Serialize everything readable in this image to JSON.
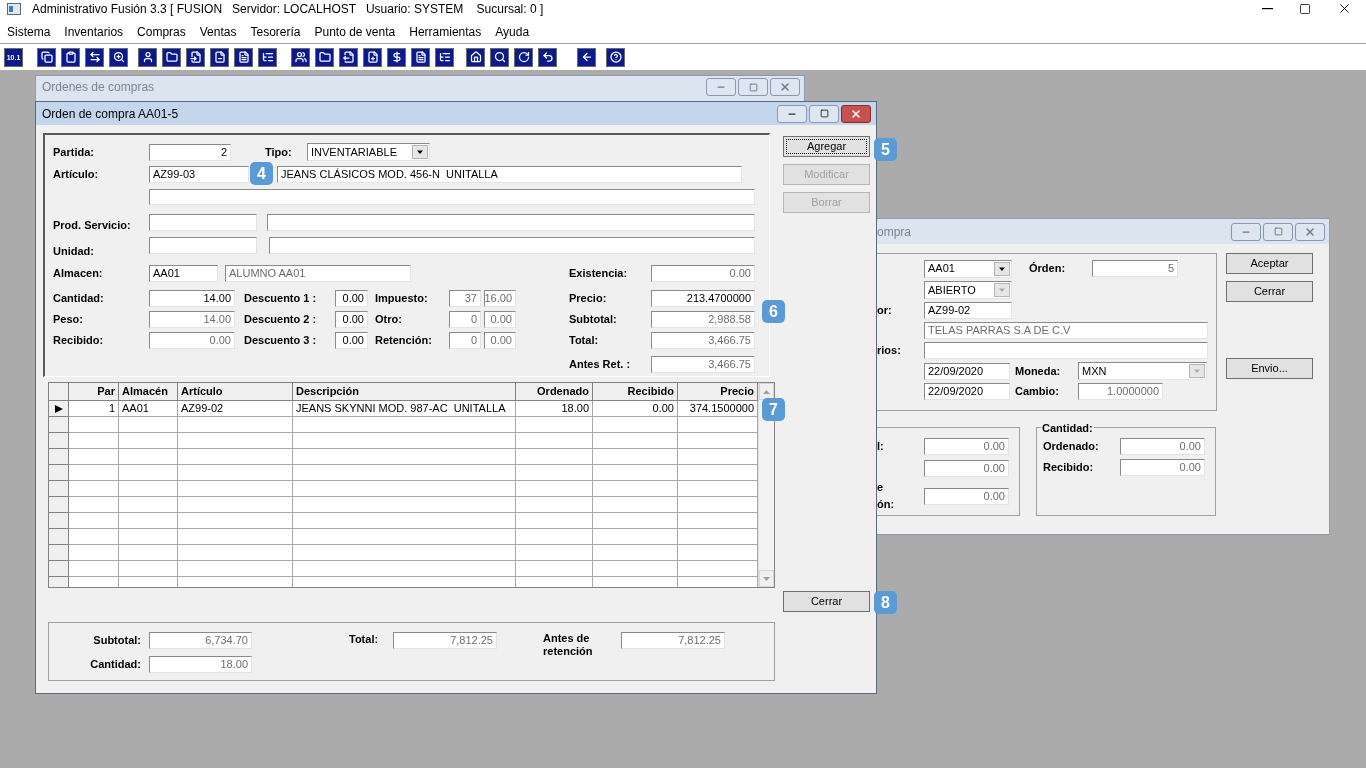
{
  "app": {
    "title": "Administrativo Fusión 3.3 [ FUSION   Servidor: LOCALHOST   Usuario: SYSTEM    Sucursal: 0 ]"
  },
  "menu": [
    "Sistema",
    "Inventarios",
    "Compras",
    "Ventas",
    "Tesorería",
    "Punto de venta",
    "Herramientas",
    "Ayuda"
  ],
  "toolbar": {
    "first_label": "10.1"
  },
  "orders_window": {
    "title": "Ordenes de compras"
  },
  "purchase_window": {
    "title": "ompra",
    "almacen": {
      "value": "AA01",
      "disabled": false
    },
    "orden_label": "Órden:",
    "orden": {
      "value": "5",
      "disabled": true
    },
    "estado": {
      "value": "ABIERTO",
      "disabled": true
    },
    "proveedor_label": "or:",
    "proveedor": {
      "value": "AZ99-02",
      "disabled": false
    },
    "proveedor_name": {
      "value": "TELAS PARRAS S.A DE C.V",
      "disabled": true
    },
    "comentarios_label": "rios:",
    "fecha": {
      "value": "22/09/2020",
      "disabled": false
    },
    "moneda_label": "Moneda:",
    "moneda": {
      "value": "MXN",
      "disabled": true
    },
    "fecha2": {
      "value": "22/09/2020",
      "disabled": false
    },
    "cambio_label": "Cambio:",
    "cambio": {
      "value": "1.0000000",
      "disabled": true
    },
    "buttons": [
      {
        "label": "Aceptar"
      },
      {
        "label": "Cerrar"
      },
      {
        "label": "Envio..."
      }
    ],
    "totals": [
      {
        "label": "l:",
        "field": {
          "value": "0.00",
          "disabled": true
        }
      },
      {
        "field": {
          "value": "0.00",
          "disabled": true
        }
      },
      {
        "label": "e",
        "label2": "ón:",
        "field": {
          "value": "0.00",
          "disabled": true
        }
      }
    ],
    "quantity_group": {
      "title": "Cantidad:",
      "rows": [
        {
          "label": "Ordenado:",
          "field": {
            "value": "0.00",
            "disabled": true
          }
        },
        {
          "label": "Recibido:",
          "field": {
            "value": "0.00",
            "disabled": true
          }
        }
      ]
    }
  },
  "order_window": {
    "title": "Orden de compra AA01-5",
    "partida_label": "Partida:",
    "partida": {
      "value": "2",
      "disabled": false
    },
    "tipo_label": "Tipo:",
    "tipo": {
      "value": "INVENTARIABLE",
      "disabled": false
    },
    "articulo_label": "Artículo:",
    "articulo": {
      "value": "AZ99-03",
      "disabled": false
    },
    "articulo_desc": {
      "value": "JEANS CLÁSICOS MOD. 456-N  UNITALLA",
      "disabled": false
    },
    "prod_servicio_label": "Prod. Servicio:",
    "unidad_label": "Unidad:",
    "almacen_label": "Almacen:",
    "almacen": {
      "value": "AA01",
      "disabled": false
    },
    "almacen_name": {
      "value": "ALUMNO AA01",
      "disabled": true
    },
    "left_rows": [
      {
        "label": "Cantidad:",
        "field": {
          "value": "14.00",
          "disabled": false
        },
        "discount_label": "Descuento 1 :",
        "discount": {
          "value": "0.00",
          "disabled": false
        },
        "tax_label": "Impuesto:",
        "tax_code": {
          "value": "37",
          "disabled": true
        },
        "tax_rate": {
          "value": "16.00",
          "disabled": true
        }
      },
      {
        "label": "Peso:",
        "field": {
          "value": "14.00",
          "disabled": true
        },
        "discount_label": "Descuento 2 :",
        "discount": {
          "value": "0.00",
          "disabled": false
        },
        "tax_label": "Otro:",
        "tax_code": {
          "value": "0",
          "disabled": true
        },
        "tax_rate": {
          "value": "0.00",
          "disabled": true
        }
      },
      {
        "label": "Recibido:",
        "field": {
          "value": "0.00",
          "disabled": true
        },
        "discount_label": "Descuento 3 :",
        "discount": {
          "value": "0.00",
          "disabled": false
        },
        "tax_label": "Retención:",
        "tax_code": {
          "value": "0",
          "disabled": true
        },
        "tax_rate": {
          "value": "0.00",
          "disabled": true
        }
      }
    ],
    "right_rows": [
      {
        "label": "Existencia:",
        "field": {
          "value": "0.00",
          "disabled": true
        }
      },
      {
        "label": "Precio:",
        "field": {
          "value": "213.4700000",
          "disabled": false
        }
      },
      {
        "label": "Subtotal:",
        "field": {
          "value": "2,988.58",
          "disabled": true
        }
      },
      {
        "label": "Total:",
        "field": {
          "value": "3,466.75",
          "disabled": true
        }
      },
      {
        "label": "Antes Ret. :",
        "field": {
          "value": "3,466.75",
          "disabled": true
        }
      }
    ],
    "buttons": [
      {
        "label": "Agregar",
        "disabled": false,
        "focused": true
      },
      {
        "label": "Modificar",
        "disabled": true,
        "focused": false
      },
      {
        "label": "Borrar",
        "disabled": true,
        "focused": false
      }
    ],
    "close_button": {
      "label": "Cerrar"
    },
    "grid": {
      "columns": [
        {
          "label": "Par",
          "numeric": true
        },
        {
          "label": "Almacén",
          "numeric": false
        },
        {
          "label": "Artículo",
          "numeric": false
        },
        {
          "label": "Descripción",
          "numeric": false
        },
        {
          "label": "Ordenado",
          "numeric": true
        },
        {
          "label": "Recibido",
          "numeric": true
        },
        {
          "label": "Precio",
          "numeric": true
        }
      ],
      "rows": [
        {
          "selected": true,
          "cells": [
            "1",
            "AA01",
            "AZ99-02",
            "JEANS SKYNNI MOD. 987-AC  UNITALLA",
            "18.00",
            "0.00",
            "374.1500000"
          ]
        }
      ]
    },
    "totals": {
      "subtotal_label": "Subtotal:",
      "subtotal": {
        "value": "6,734.70",
        "disabled": true
      },
      "cantidad_label": "Cantidad:",
      "cantidad": {
        "value": "18.00",
        "disabled": true
      },
      "total_label": "Total:",
      "total": {
        "value": "7,812.25",
        "disabled": true
      },
      "antes_label": "Antes de retención",
      "antes": {
        "value": "7,812.25",
        "disabled": true
      }
    }
  },
  "callouts": [
    "4",
    "5",
    "6",
    "7",
    "8"
  ]
}
